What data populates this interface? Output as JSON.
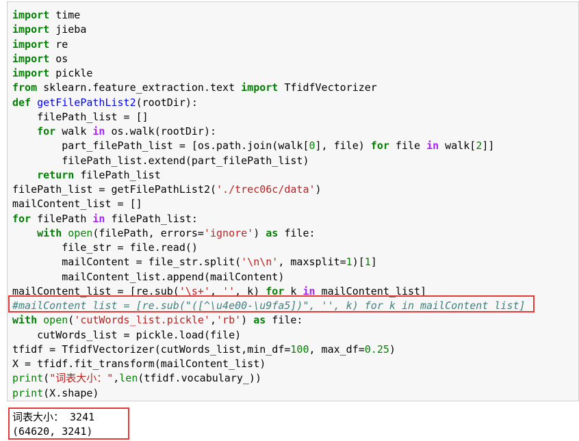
{
  "code_lines": [
    [
      {
        "t": "import",
        "c": "kw"
      },
      {
        "t": " time",
        "c": ""
      }
    ],
    [
      {
        "t": "import",
        "c": "kw"
      },
      {
        "t": " jieba",
        "c": ""
      }
    ],
    [
      {
        "t": "import",
        "c": "kw"
      },
      {
        "t": " re",
        "c": ""
      }
    ],
    [
      {
        "t": "import",
        "c": "kw"
      },
      {
        "t": " os",
        "c": ""
      }
    ],
    [
      {
        "t": "import",
        "c": "kw"
      },
      {
        "t": " pickle",
        "c": ""
      }
    ],
    [
      {
        "t": "from",
        "c": "kw"
      },
      {
        "t": " sklearn.feature_extraction.text ",
        "c": ""
      },
      {
        "t": "import",
        "c": "kw"
      },
      {
        "t": " TfidfVectorizer",
        "c": ""
      }
    ],
    [
      {
        "t": "def",
        "c": "kw"
      },
      {
        "t": " ",
        "c": ""
      },
      {
        "t": "getFilePathList2",
        "c": "fn"
      },
      {
        "t": "(rootDir):",
        "c": ""
      }
    ],
    [
      {
        "t": "    filePath_list = []",
        "c": ""
      }
    ],
    [
      {
        "t": "    ",
        "c": ""
      },
      {
        "t": "for",
        "c": "kw"
      },
      {
        "t": " walk ",
        "c": ""
      },
      {
        "t": "in",
        "c": "op"
      },
      {
        "t": " os.walk(rootDir):",
        "c": ""
      }
    ],
    [
      {
        "t": "        part_filePath_list = [os.path.join(walk[",
        "c": ""
      },
      {
        "t": "0",
        "c": "num"
      },
      {
        "t": "], file) ",
        "c": ""
      },
      {
        "t": "for",
        "c": "kw"
      },
      {
        "t": " file ",
        "c": ""
      },
      {
        "t": "in",
        "c": "op"
      },
      {
        "t": " walk[",
        "c": ""
      },
      {
        "t": "2",
        "c": "num"
      },
      {
        "t": "]]",
        "c": ""
      }
    ],
    [
      {
        "t": "        filePath_list.extend(part_filePath_list)",
        "c": ""
      }
    ],
    [
      {
        "t": "    ",
        "c": ""
      },
      {
        "t": "return",
        "c": "kw"
      },
      {
        "t": " filePath_list",
        "c": ""
      }
    ],
    [
      {
        "t": "filePath_list = getFilePathList2(",
        "c": ""
      },
      {
        "t": "'./trec06c/data'",
        "c": "str"
      },
      {
        "t": ")",
        "c": ""
      }
    ],
    [
      {
        "t": "mailContent_list = []",
        "c": ""
      }
    ],
    [
      {
        "t": "for",
        "c": "kw"
      },
      {
        "t": " filePath ",
        "c": ""
      },
      {
        "t": "in",
        "c": "op"
      },
      {
        "t": " filePath_list:",
        "c": ""
      }
    ],
    [
      {
        "t": "    ",
        "c": ""
      },
      {
        "t": "with",
        "c": "kw"
      },
      {
        "t": " ",
        "c": ""
      },
      {
        "t": "open",
        "c": "bi"
      },
      {
        "t": "(filePath, errors=",
        "c": ""
      },
      {
        "t": "'ignore'",
        "c": "str"
      },
      {
        "t": ") ",
        "c": ""
      },
      {
        "t": "as",
        "c": "kw"
      },
      {
        "t": " file:",
        "c": ""
      }
    ],
    [
      {
        "t": "        file_str = file.read()",
        "c": ""
      }
    ],
    [
      {
        "t": "        mailContent = file_str.split(",
        "c": ""
      },
      {
        "t": "'\\n\\n'",
        "c": "str"
      },
      {
        "t": ", maxsplit=",
        "c": ""
      },
      {
        "t": "1",
        "c": "num"
      },
      {
        "t": ")[",
        "c": ""
      },
      {
        "t": "1",
        "c": "num"
      },
      {
        "t": "]",
        "c": ""
      }
    ],
    [
      {
        "t": "        mailContent_list.append(mailContent)",
        "c": ""
      }
    ],
    [
      {
        "t": "mailContent_list = [re.sub(",
        "c": ""
      },
      {
        "t": "'\\s+'",
        "c": "str"
      },
      {
        "t": ", ",
        "c": ""
      },
      {
        "t": "''",
        "c": "str"
      },
      {
        "t": ", k) ",
        "c": ""
      },
      {
        "t": "for",
        "c": "kw"
      },
      {
        "t": " k ",
        "c": ""
      },
      {
        "t": "in",
        "c": "op"
      },
      {
        "t": " mailContent_list]",
        "c": ""
      }
    ],
    [
      {
        "t": "#mailContent_list = [re.sub(\"([^\\u4e00-\\u9fa5])\", '', k) for k in mailContent_list]",
        "c": "cm"
      }
    ],
    [
      {
        "t": "with",
        "c": "kw"
      },
      {
        "t": " ",
        "c": ""
      },
      {
        "t": "open",
        "c": "bi"
      },
      {
        "t": "(",
        "c": ""
      },
      {
        "t": "'cutWords_list.pickle'",
        "c": "str"
      },
      {
        "t": ",",
        "c": ""
      },
      {
        "t": "'rb'",
        "c": "str"
      },
      {
        "t": ") ",
        "c": ""
      },
      {
        "t": "as",
        "c": "kw"
      },
      {
        "t": " file:",
        "c": ""
      }
    ],
    [
      {
        "t": "    cutWords_list = pickle.load(file)",
        "c": ""
      }
    ],
    [
      {
        "t": "tfidf = TfidfVectorizer(cutWords_list,min_df=",
        "c": ""
      },
      {
        "t": "100",
        "c": "num"
      },
      {
        "t": ", max_df=",
        "c": ""
      },
      {
        "t": "0.25",
        "c": "num"
      },
      {
        "t": ")",
        "c": ""
      }
    ],
    [
      {
        "t": "X = tfidf.fit_transform(mailContent_list)",
        "c": ""
      }
    ],
    [
      {
        "t": "print",
        "c": "bi"
      },
      {
        "t": "(",
        "c": ""
      },
      {
        "t": "\"词表大小：\"",
        "c": "str"
      },
      {
        "t": ",",
        "c": ""
      },
      {
        "t": "len",
        "c": "bi"
      },
      {
        "t": "(tfidf.vocabulary_))",
        "c": ""
      }
    ],
    [
      {
        "t": "print",
        "c": "bi"
      },
      {
        "t": "(X.shape)",
        "c": ""
      }
    ]
  ],
  "output_lines": [
    "词表大小： 3241",
    "(64620, 3241)"
  ],
  "highlight_color": "#e53935"
}
